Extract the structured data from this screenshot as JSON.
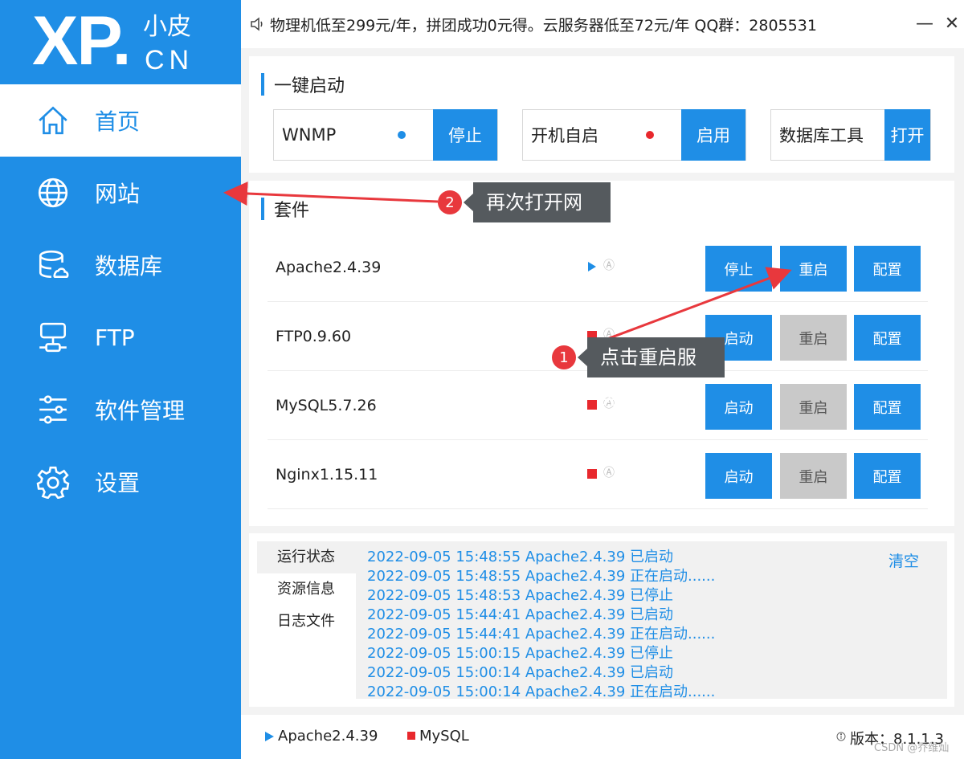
{
  "logo": {
    "main": "XP.",
    "small": "小皮",
    "domain": "CN"
  },
  "sidebar": {
    "items": [
      {
        "label": "首页",
        "icon": "home-icon"
      },
      {
        "label": "网站",
        "icon": "globe-icon"
      },
      {
        "label": "数据库",
        "icon": "database-icon"
      },
      {
        "label": "FTP",
        "icon": "ftp-icon"
      },
      {
        "label": "软件管理",
        "icon": "sliders-icon"
      },
      {
        "label": "设置",
        "icon": "gear-icon"
      }
    ]
  },
  "topbar": {
    "notice": "物理机低至299元/年，拼团成功0元得。云服务器低至72元/年  QQ群：2805531",
    "minimize": "—",
    "close": "✕"
  },
  "quick_start": {
    "title": "一键启动",
    "items": [
      {
        "label": "WNMP",
        "button": "停止",
        "status_color": "#1f8ee6"
      },
      {
        "label": "开机自启",
        "button": "启用",
        "status_color": "#e8282d"
      },
      {
        "label": "数据库工具",
        "button": "打开"
      }
    ]
  },
  "suite": {
    "title": "套件",
    "auto_icon": "Ⓐ",
    "rows": [
      {
        "name": "Apache2.4.39",
        "state": "running",
        "btn1": "停止",
        "btn2": "重启",
        "btn3": "配置"
      },
      {
        "name": "FTP0.9.60",
        "state": "stopped",
        "btn1": "启动",
        "btn2": "重启",
        "btn3": "配置"
      },
      {
        "name": "MySQL5.7.26",
        "state": "stopped",
        "btn1": "启动",
        "btn2": "重启",
        "btn3": "配置"
      },
      {
        "name": "Nginx1.15.11",
        "state": "stopped",
        "btn1": "启动",
        "btn2": "重启",
        "btn3": "配置"
      }
    ]
  },
  "log": {
    "tabs": [
      "运行状态",
      "资源信息",
      "日志文件"
    ],
    "clear": "清空",
    "lines": [
      "2022-09-05 15:48:55 Apache2.4.39 已启动",
      "2022-09-05 15:48:55 Apache2.4.39 正在启动......",
      "2022-09-05 15:48:53 Apache2.4.39 已停止",
      "2022-09-05 15:44:41 Apache2.4.39 已启动",
      "2022-09-05 15:44:41 Apache2.4.39 正在启动......",
      "2022-09-05 15:00:15 Apache2.4.39 已停止",
      "2022-09-05 15:00:14 Apache2.4.39 已启动",
      "2022-09-05 15:00:14 Apache2.4.39 正在启动......"
    ]
  },
  "footer": {
    "apache": "Apache2.4.39",
    "mysql": "MySQL",
    "version": "版本：8.1.1.3",
    "watermark": "CSDN @乔维灿"
  },
  "annotations": {
    "one": {
      "num": "1",
      "text": "点击重启服务"
    },
    "two": {
      "num": "2",
      "text": "再次打开网站"
    }
  },
  "colors": {
    "primary": "#1f8ee6",
    "stopped": "#e8282d",
    "disabled": "#c9c9c9"
  }
}
